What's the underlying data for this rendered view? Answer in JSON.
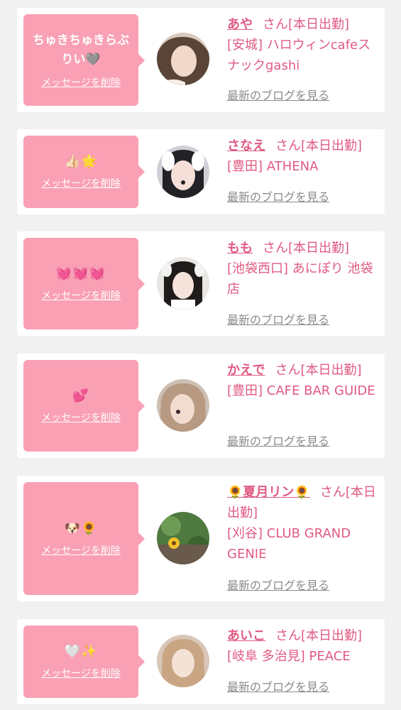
{
  "delete_label": "メッセージを削除",
  "blog_label": "最新のブログを見る",
  "suffix_text": "さん[本日出勤]",
  "colors": {
    "accent": "#e05a82",
    "bubble": "#f9a0b5",
    "background": "#f1f1f1"
  },
  "items": [
    {
      "name": "あや",
      "area": "[安城]",
      "shop": "ハロウィンcafeスナックgashi",
      "message": "ちゅきちゅきらぶりい🩶"
    },
    {
      "name": "さなえ",
      "area": "[豊田]",
      "shop": "ATHENA",
      "message": "👍🏻🌟"
    },
    {
      "name": "もも",
      "area": "[池袋西口]",
      "shop": "あにぽり 池袋店",
      "message": "💓💓💓"
    },
    {
      "name": "かえで",
      "area": "[豊田]",
      "shop": "CAFE BAR GUIDE",
      "message": "💕"
    },
    {
      "name": "🌻夏月リン🌻",
      "area": "[刈谷]",
      "shop": "CLUB GRAND GENIE",
      "message": "🐶🌻"
    },
    {
      "name": "あいこ",
      "area": "[岐阜 多治見]",
      "shop": "PEACE",
      "message": "🤍✨"
    }
  ]
}
